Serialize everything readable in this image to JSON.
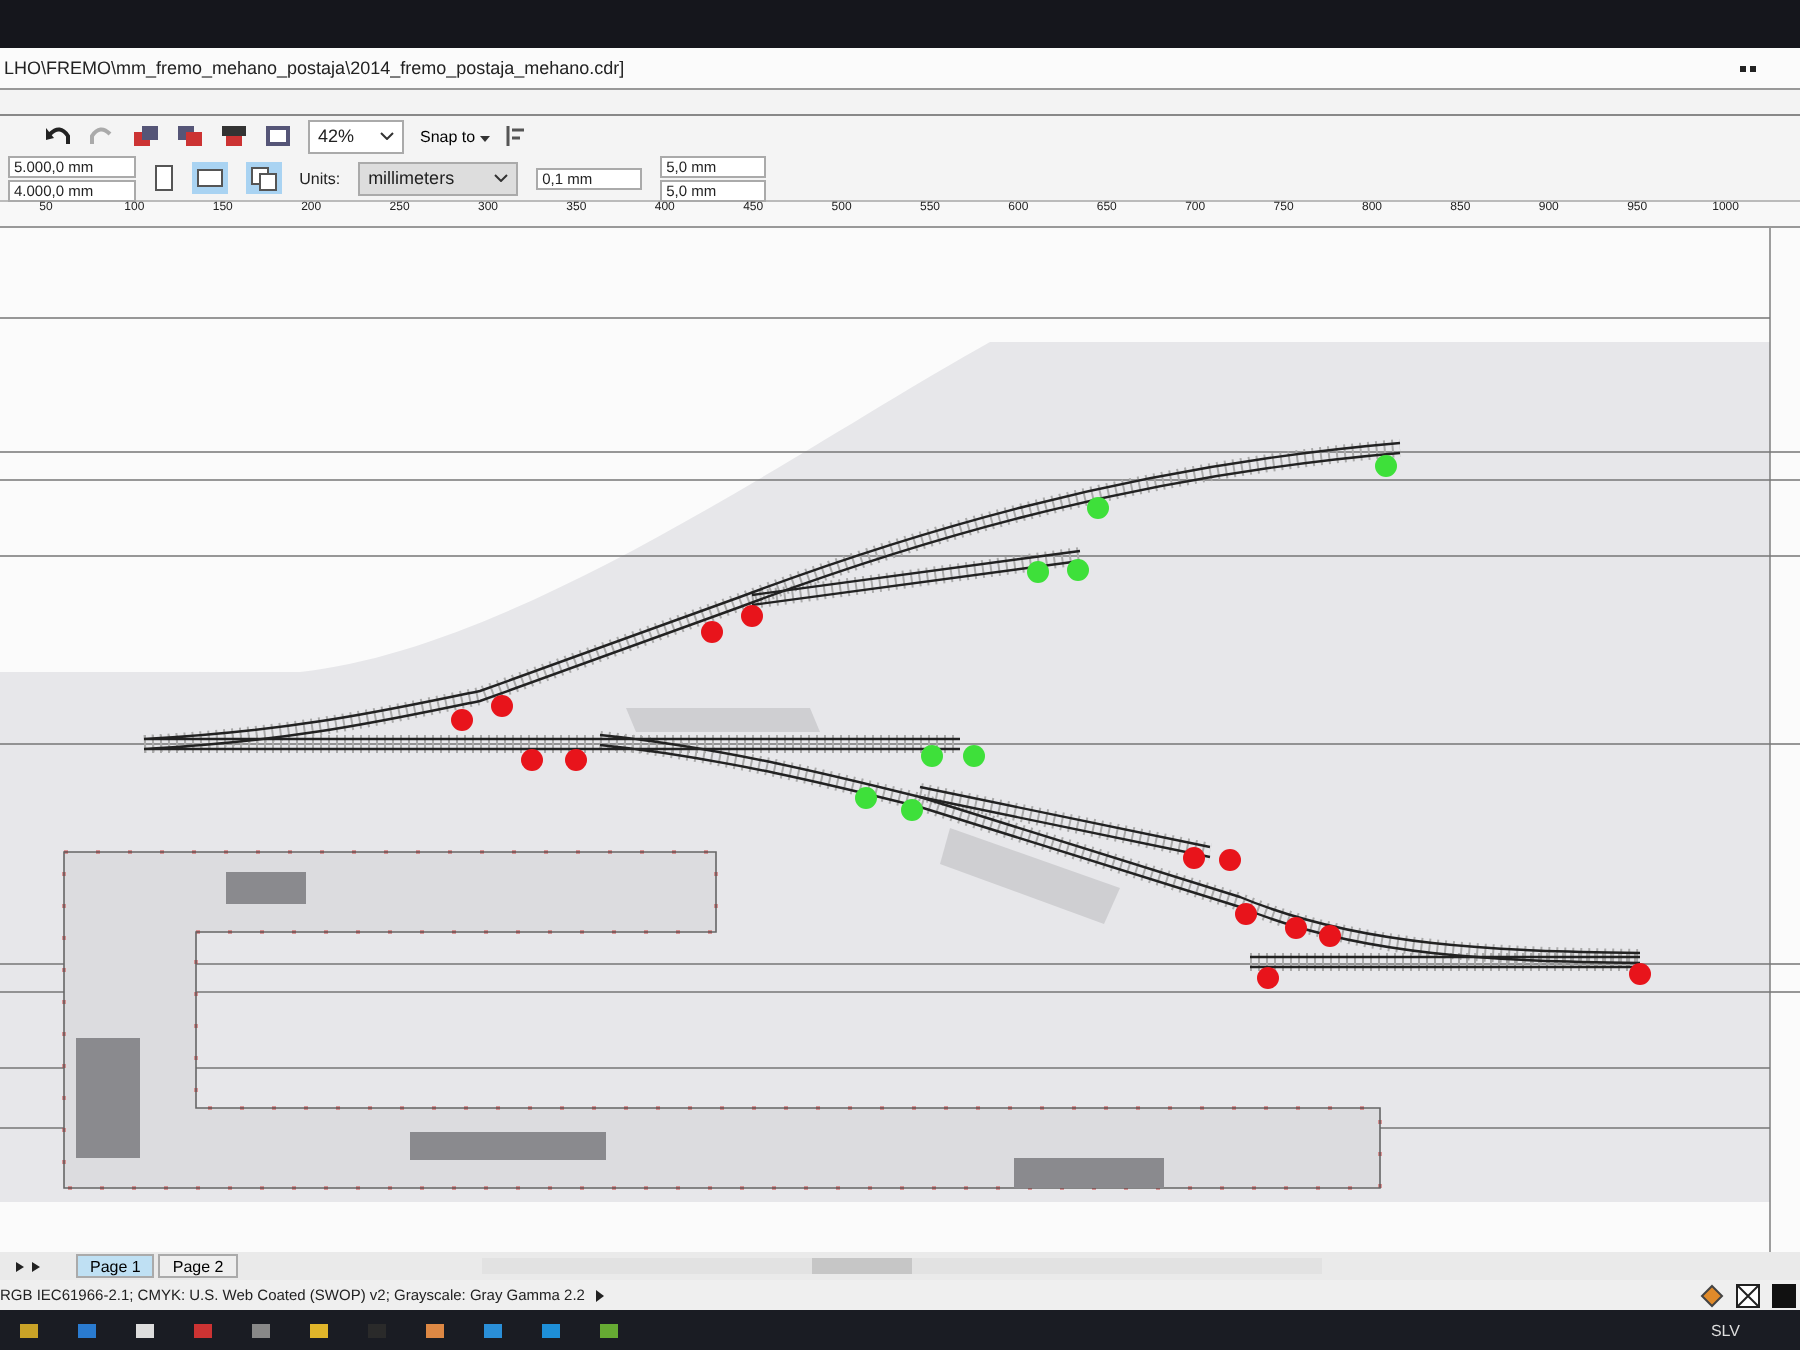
{
  "window": {
    "title": "LHO\\FREMO\\mm_fremo_mehano_postaja\\2014_fremo_postaja_mehano.cdr]"
  },
  "toolbar": {
    "zoom": "42%",
    "snap": "Snap to"
  },
  "property_bar": {
    "width": "5.000,0 mm",
    "height": "4.000,0 mm",
    "units_label": "Units:",
    "units": "millimeters",
    "nudge": "0,1 mm",
    "duplicate_x": "5,0 mm",
    "duplicate_y": "5,0 mm"
  },
  "ruler": {
    "labels": [
      "50",
      "100",
      "150",
      "200",
      "250",
      "300",
      "350",
      "400",
      "450",
      "500",
      "550",
      "600",
      "650",
      "700",
      "750",
      "800",
      "850",
      "900",
      "950",
      "1000"
    ]
  },
  "signals": [
    {
      "color": "#3ee03a"
    },
    {
      "color": "#3ee03a"
    },
    {
      "color": "#3ee03a"
    },
    {
      "color": "#3ee03a"
    },
    {
      "color": "#3ee03a"
    },
    {
      "color": "#3ee03a"
    },
    {
      "color": "#3ee03a"
    },
    {
      "color": "#3ee03a"
    },
    {
      "color": "#e8141b"
    },
    {
      "color": "#e8141b"
    },
    {
      "color": "#e8141b"
    },
    {
      "color": "#e8141b"
    },
    {
      "color": "#e8141b"
    },
    {
      "color": "#e8141b"
    },
    {
      "color": "#e8141b"
    },
    {
      "color": "#e8141b"
    },
    {
      "color": "#e8141b"
    },
    {
      "color": "#e8141b"
    },
    {
      "color": "#e8141b"
    },
    {
      "color": "#e8141b"
    },
    {
      "color": "#e8141b"
    }
  ],
  "page_tabs": [
    {
      "label": "Page 1",
      "selected": true
    },
    {
      "label": "Page 2",
      "selected": false
    }
  ],
  "status_bar": {
    "text": "RGB IEC61966-2.1; CMYK: U.S. Web Coated (SWOP) v2; Grayscale: Gray Gamma 2.2"
  },
  "taskbar": {
    "tray_text": "SLV"
  }
}
